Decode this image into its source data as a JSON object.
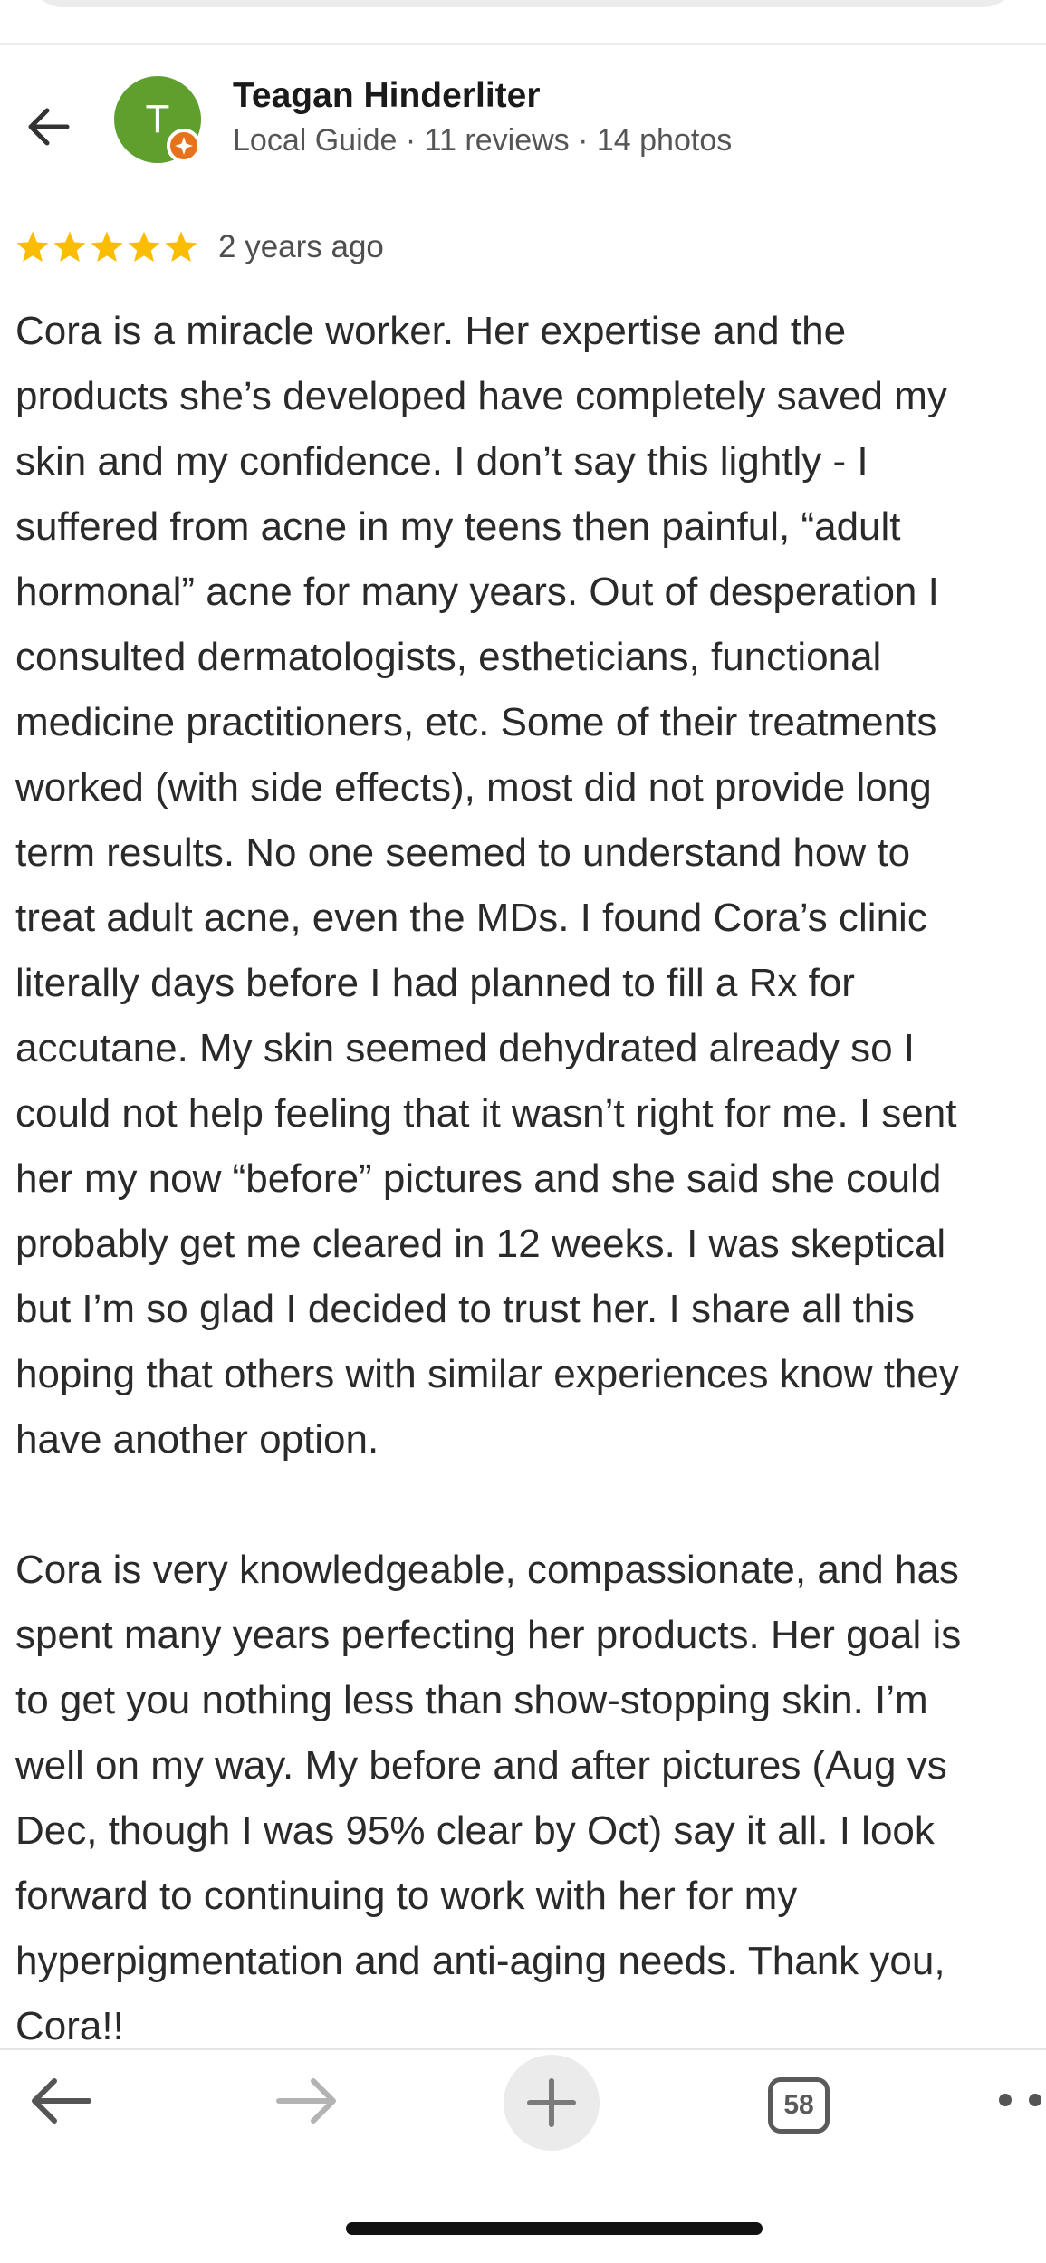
{
  "reviewer": {
    "initial": "T",
    "name": "Teagan Hinderliter",
    "meta": "Local Guide · 11 reviews · 14 photos",
    "avatar_color": "#5f9f2e",
    "badge_color": "#e8711c"
  },
  "review": {
    "rating": 5,
    "star_color": "#fbbc04",
    "date": "2 years ago",
    "paragraphs": [
      [
        "Cora is a miracle worker. Her expertise and the",
        "products she’s developed have completely saved my",
        "skin and my confidence. I don’t say this lightly - I",
        "suffered from acne in my teens then painful, “adult",
        "hormonal” acne for many years. Out of desperation I",
        "consulted dermatologists, estheticians, functional",
        "medicine practitioners, etc. Some of their treatments",
        "worked (with side effects), most did not provide long",
        "term results. No one seemed to understand how to",
        "treat adult acne, even the MDs. I found Cora’s clinic",
        "literally days before I had planned to fill a Rx for",
        "accutane. My skin seemed dehydrated already so I",
        "could not help feeling that it wasn’t right for me. I sent",
        "her my now “before” pictures and she said she could",
        "probably get me cleared in 12 weeks. I was skeptical",
        "but I’m so glad I decided to trust her. I share all this",
        "hoping that others with similar experiences know they",
        "have another option."
      ],
      [
        "Cora is very knowledgeable, compassionate, and has",
        "spent many years perfecting her products. Her goal is",
        "to get you nothing less than show-stopping skin. I’m",
        "well on my way. My before and after pictures (Aug vs",
        "Dec, though I was 95% clear by Oct) say it all. I look",
        "forward to continuing to work with her for my",
        "hyperpigmentation and anti-aging needs. Thank you,",
        "Cora!!"
      ]
    ]
  },
  "browser": {
    "tab_count": "58",
    "icons": [
      "back-arrow-icon",
      "forward-arrow-icon",
      "plus-icon",
      "tabs-icon",
      "more-dots-icon"
    ]
  }
}
